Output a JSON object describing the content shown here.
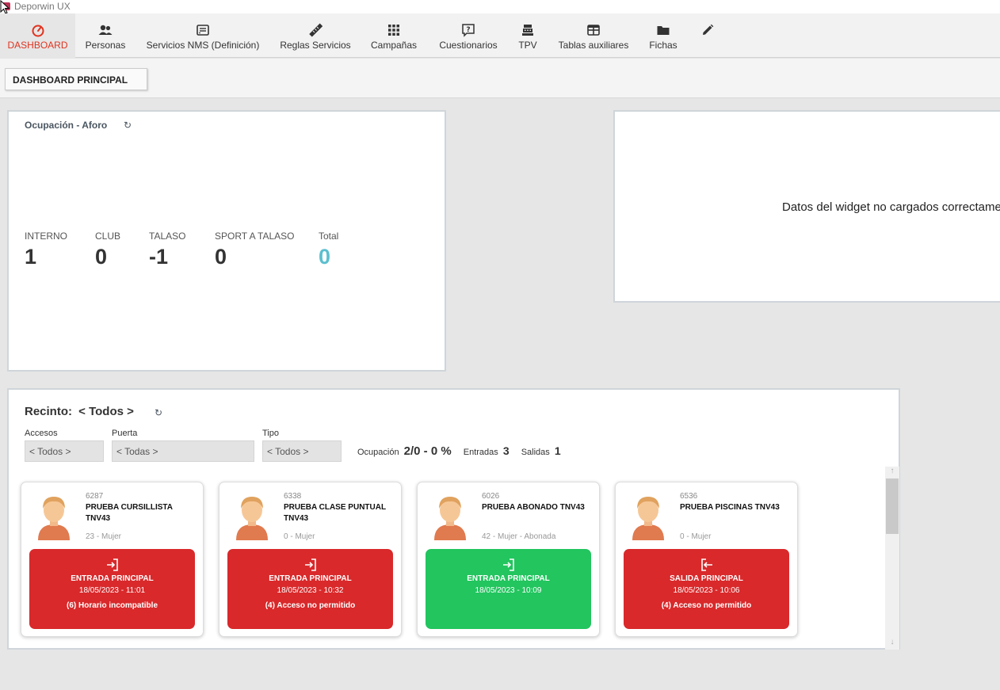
{
  "window": {
    "title": "Deporwin UX"
  },
  "menu": [
    {
      "label": "DASHBOARD",
      "icon": "dashboard-gauge-icon",
      "active": true
    },
    {
      "label": "Personas",
      "icon": "people-icon"
    },
    {
      "label": "Servicios NMS (Definición)",
      "icon": "service-card-icon"
    },
    {
      "label": "Reglas Servicios",
      "icon": "ruler-icon"
    },
    {
      "label": "Campañas",
      "icon": "grid-icon"
    },
    {
      "label": "Cuestionarios",
      "icon": "question-box-icon"
    },
    {
      "label": "TPV",
      "icon": "cash-register-icon"
    },
    {
      "label": "Tablas auxiliares",
      "icon": "table-icon"
    },
    {
      "label": "Fichas",
      "icon": "folder-icon"
    }
  ],
  "menu_edit_icon": "pencil-icon",
  "subtab": {
    "label": "DASHBOARD PRINCIPAL"
  },
  "occupancy": {
    "title": "Ocupación - Aforo",
    "columns": [
      {
        "label": "INTERNO",
        "value": "1"
      },
      {
        "label": "CLUB",
        "value": "0"
      },
      {
        "label": "TALASO",
        "value": "-1"
      },
      {
        "label": "SPORT A TALASO",
        "value": "0"
      },
      {
        "label": "Total",
        "value": "0"
      }
    ]
  },
  "widget": {
    "message": "Datos del widget no cargados correctamente"
  },
  "recinto": {
    "label": "Recinto:",
    "value": "< Todos >",
    "filters": [
      {
        "label": "Accesos",
        "value": "< Todos >"
      },
      {
        "label": "Puerta",
        "value": "< Todas >"
      },
      {
        "label": "Tipo",
        "value": "< Todos >"
      }
    ],
    "stats": {
      "ocupacion_label": "Ocupación",
      "ocupacion_value": "2/0 - 0 %",
      "entradas_label": "Entradas",
      "entradas_value": "3",
      "salidas_label": "Salidas",
      "salidas_value": "1"
    }
  },
  "colors": {
    "accent": "#e0331f",
    "status_red": "#d9292b",
    "status_green": "#22c55e",
    "total": "#5bbfcf"
  },
  "cards": [
    {
      "id": "6287",
      "name": "PRUEBA CURSILLISTA TNV43",
      "info": "23 - Mujer",
      "status": "denied",
      "direction": "in",
      "door": "ENTRADA PRINCIPAL",
      "datetime": "18/05/2023 - 11:01",
      "reason": "(6) Horario incompatible"
    },
    {
      "id": "6338",
      "name": "PRUEBA CLASE PUNTUAL TNV43",
      "info": "0 - Mujer",
      "status": "denied",
      "direction": "in",
      "door": "ENTRADA PRINCIPAL",
      "datetime": "18/05/2023 - 10:32",
      "reason": "(4) Acceso no permitido"
    },
    {
      "id": "6026",
      "name": "PRUEBA ABONADO TNV43",
      "info": "42 - Mujer - Abonada",
      "status": "allowed",
      "direction": "in",
      "door": "ENTRADA PRINCIPAL",
      "datetime": "18/05/2023 - 10:09",
      "reason": ""
    },
    {
      "id": "6536",
      "name": "PRUEBA PISCINAS TNV43",
      "info": "0 - Mujer",
      "status": "denied",
      "direction": "out",
      "door": "SALIDA PRINCIPAL",
      "datetime": "18/05/2023 - 10:06",
      "reason": "(4) Acceso no permitido"
    }
  ]
}
